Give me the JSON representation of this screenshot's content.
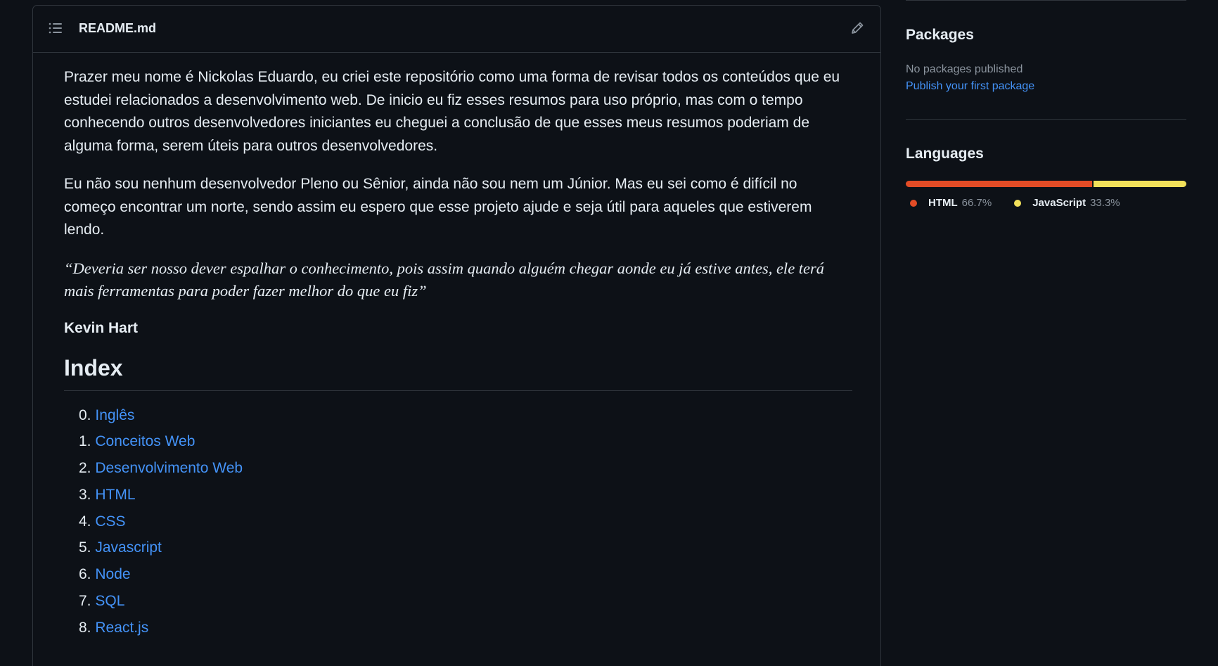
{
  "readme": {
    "title": "README.md",
    "paragraphs": [
      "Prazer meu nome é Nickolas Eduardo, eu criei este repositório como uma forma de revisar todos os conteúdos que eu estudei relacionados a desenvolvimento web. De inicio eu fiz esses resumos para uso próprio, mas com o tempo conhecendo outros desenvolvedores iniciantes eu cheguei a conclusão de que esses meus resumos poderiam de alguma forma, serem úteis para outros desenvolvedores.",
      "Eu não sou nenhum desenvolvedor Pleno ou Sênior, ainda não sou nem um Júnior. Mas eu sei como é difícil no começo encontrar um norte, sendo assim eu espero que esse projeto ajude e seja útil para aqueles que estiverem lendo."
    ],
    "quote": "“Deveria ser nosso dever espalhar o conhecimento, pois assim quando alguém chegar aonde eu já estive antes, ele terá mais ferramentas para poder fazer melhor do que eu fiz”",
    "author": "Kevin Hart",
    "index_heading": "Index",
    "index": [
      {
        "num": "0.",
        "label": "Inglês"
      },
      {
        "num": "1.",
        "label": "Conceitos Web"
      },
      {
        "num": "2.",
        "label": "Desenvolvimento Web"
      },
      {
        "num": "3.",
        "label": "HTML"
      },
      {
        "num": "4.",
        "label": "CSS"
      },
      {
        "num": "5.",
        "label": "Javascript"
      },
      {
        "num": "6.",
        "label": "Node"
      },
      {
        "num": "7.",
        "label": "SQL"
      },
      {
        "num": "8.",
        "label": "React.js"
      }
    ]
  },
  "sidebar": {
    "packages": {
      "title": "Packages",
      "empty_text": "No packages published",
      "publish_link": "Publish your first package"
    },
    "languages": {
      "title": "Languages",
      "items": [
        {
          "name": "HTML",
          "percent": "66.7%",
          "value": 66.7,
          "color": "#e34c26"
        },
        {
          "name": "JavaScript",
          "percent": "33.3%",
          "value": 33.3,
          "color": "#f1e05a"
        }
      ]
    }
  },
  "icons": {
    "toc": "list-unordered-icon",
    "edit": "pencil-icon"
  },
  "colors": {
    "background": "#0d1117",
    "border": "#30363d",
    "link": "#4493f8",
    "muted": "#8b949e",
    "text": "#e6edf3"
  }
}
